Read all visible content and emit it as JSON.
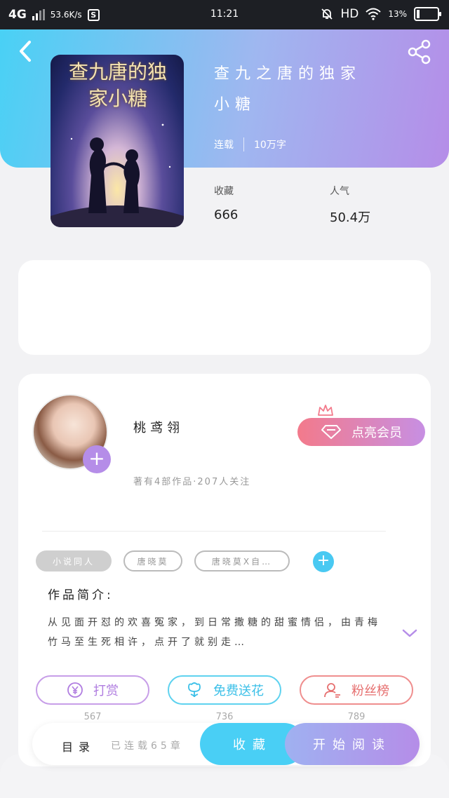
{
  "status_bar": {
    "network": "4G",
    "speed": "53.6K/s",
    "s_badge": "S",
    "time": "11:21",
    "hd": "HD",
    "battery_pct": "13%",
    "battery_level": 0.13
  },
  "book": {
    "cover_title": "查九唐的独家小糖",
    "title_line1": "查九之唐的独家",
    "title_line2": "小糖",
    "serial_status": "连载",
    "word_count": "10万字",
    "stats": [
      {
        "label": "收藏",
        "value": "666"
      },
      {
        "label": "人气",
        "value": "50.4万"
      }
    ]
  },
  "author": {
    "name": "桃鸢翎",
    "meta": "著有4部作品·207人关注",
    "vip_button": "点亮会员"
  },
  "tags": [
    "小说同人",
    "唐晓莫",
    "唐晓莫X自…"
  ],
  "intro": {
    "title": "作品简介:",
    "text": "从见面开怼的欢喜冤家，到日常撒糖的甜蜜情侣，由青梅竹马至生死相许，点开了就别走…"
  },
  "actions": [
    {
      "label": "打赏",
      "count": "567"
    },
    {
      "label": "免费送花",
      "count": "736"
    },
    {
      "label": "粉丝榜",
      "count": "789"
    }
  ],
  "bottom_bar": {
    "catalog": "目录",
    "progress": "已连载65章",
    "collect": "收藏",
    "read": "开始阅读"
  },
  "colors": {
    "accent_blue": "#49cff5",
    "accent_purple": "#b58de8",
    "accent_pink": "#f37a8b"
  }
}
